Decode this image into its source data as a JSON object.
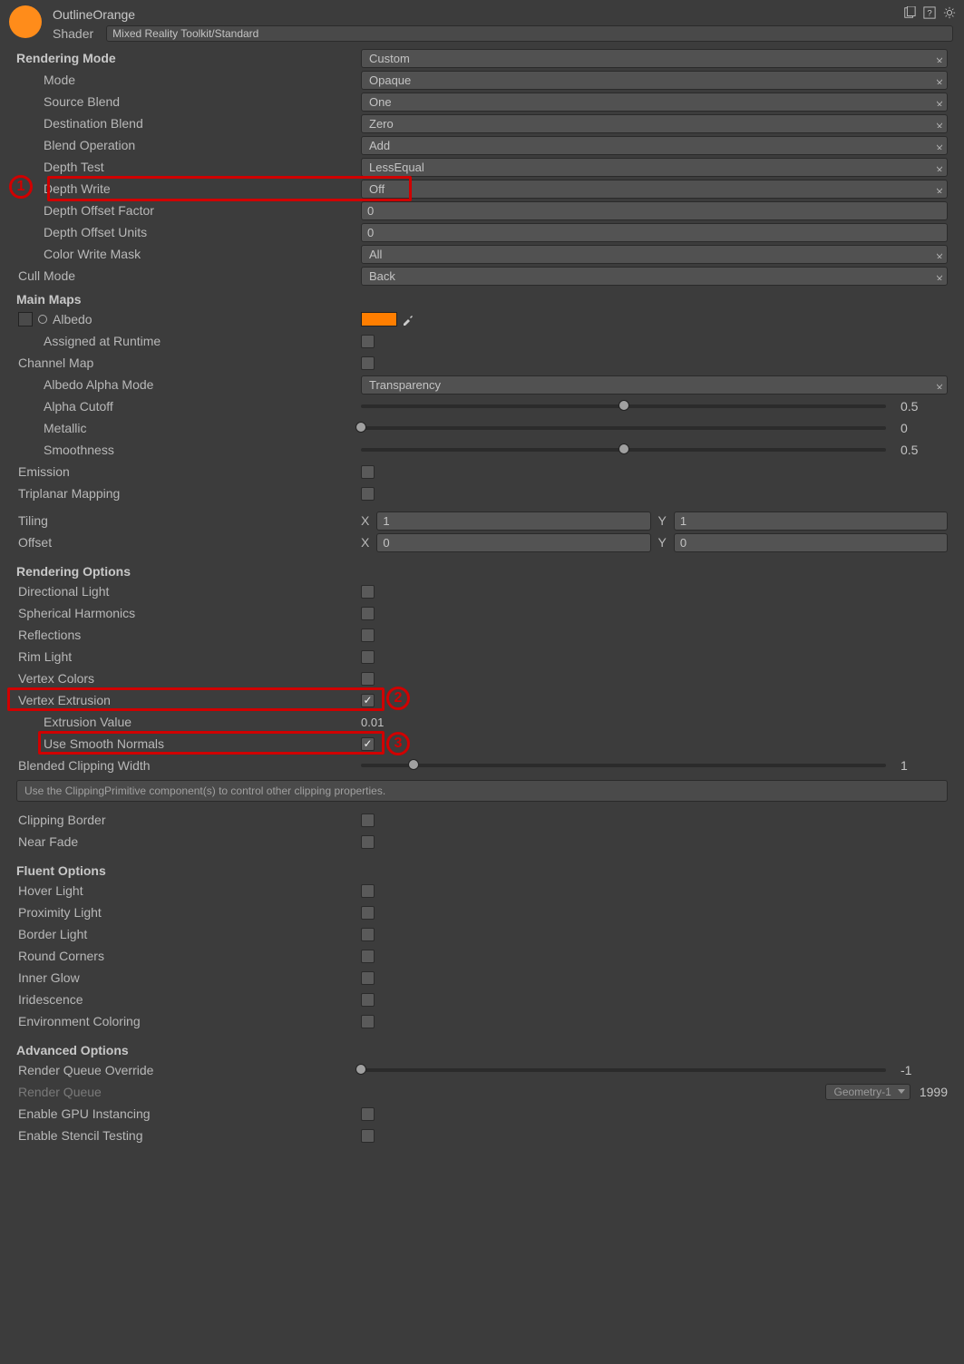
{
  "hd": {
    "title": "OutlineOrange",
    "shaderLbl": "Shader",
    "shaderVal": "Mixed Reality Toolkit/Standard"
  },
  "rm": {
    "title": "Rendering Mode",
    "modeLbl": "Mode",
    "modeVal": "Opaque",
    "srcLbl": "Source Blend",
    "srcVal": "One",
    "dstLbl": "Destination Blend",
    "dstVal": "Zero",
    "opLbl": "Blend Operation",
    "opVal": "Add",
    "dtLbl": "Depth Test",
    "dtVal": "LessEqual",
    "dwLbl": "Depth Write",
    "dwVal": "Off",
    "dofLbl": "Depth Offset Factor",
    "dofVal": "0",
    "douLbl": "Depth Offset Units",
    "douVal": "0",
    "cwmLbl": "Color Write Mask",
    "cwmVal": "All",
    "cullLbl": "Cull Mode",
    "cullVal": "Back"
  },
  "mm": {
    "title": "Main Maps",
    "albedoLbl": "Albedo",
    "assignedLbl": "Assigned at Runtime",
    "chanLbl": "Channel Map",
    "aamLbl": "Albedo Alpha Mode",
    "aamVal": "Transparency",
    "cutLbl": "Alpha Cutoff",
    "cutVal": "0.5",
    "cutPct": 50,
    "metLbl": "Metallic",
    "metVal": "0",
    "metPct": 0,
    "smoLbl": "Smoothness",
    "smoVal": "0.5",
    "smoPct": 50,
    "emLbl": "Emission",
    "triLbl": "Triplanar Mapping",
    "tilLbl": "Tiling",
    "tilX": "1",
    "tilY": "1",
    "offLbl": "Offset",
    "offX": "0",
    "offY": "0"
  },
  "ro": {
    "title": "Rendering Options",
    "dlLbl": "Directional Light",
    "shLbl": "Spherical Harmonics",
    "rfLbl": "Reflections",
    "rlLbl": "Rim Light",
    "vcLbl": "Vertex Colors",
    "veLbl": "Vertex Extrusion",
    "evLbl": "Extrusion Value",
    "evVal": "0.01",
    "snLbl": "Use Smooth Normals",
    "bcwLbl": "Blended Clipping Width",
    "bcwVal": "1",
    "bcwPct": 10,
    "hint": "Use the ClippingPrimitive component(s) to control other clipping properties.",
    "cbLbl": "Clipping Border",
    "nfLbl": "Near Fade"
  },
  "fo": {
    "title": "Fluent Options",
    "hvLbl": "Hover Light",
    "pxLbl": "Proximity Light",
    "blLbl": "Border Light",
    "rcLbl": "Round Corners",
    "igLbl": "Inner Glow",
    "irLbl": "Iridescence",
    "ecLbl": "Environment Coloring"
  },
  "ao": {
    "title": "Advanced Options",
    "rqoLbl": "Render Queue Override",
    "rqoVal": "-1",
    "rqoPct": 0,
    "rqLbl": "Render Queue",
    "rqDd": "Geometry-1",
    "rqNum": "1999",
    "giLbl": "Enable GPU Instancing",
    "stLbl": "Enable Stencil Testing"
  },
  "anno": {
    "n1": "1",
    "n2": "2",
    "n3": "3"
  }
}
